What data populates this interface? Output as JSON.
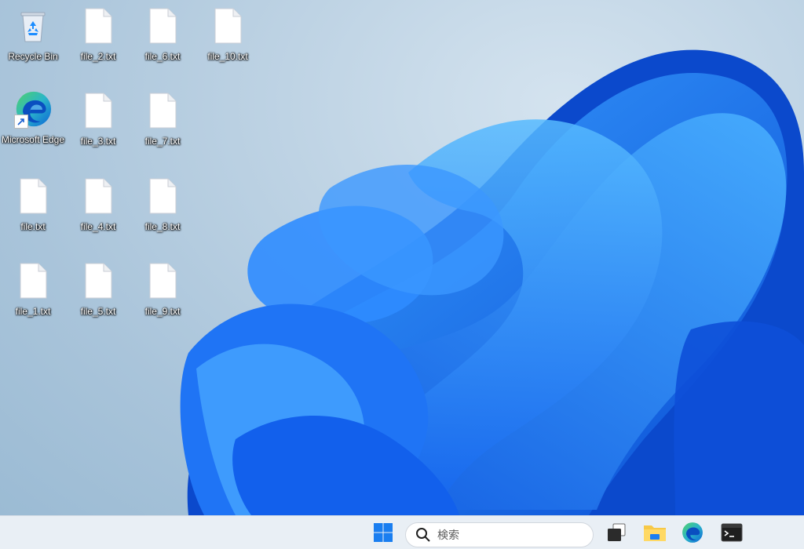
{
  "desktop": {
    "icons": [
      {
        "label": "Recycle Bin",
        "icon": "recycle-bin-icon"
      },
      {
        "label": "file_2.txt",
        "icon": "text-file-icon"
      },
      {
        "label": "file_6.txt",
        "icon": "text-file-icon"
      },
      {
        "label": "file_10.txt",
        "icon": "text-file-icon"
      },
      {
        "label": "Microsoft Edge",
        "icon": "edge-icon"
      },
      {
        "label": "file_3.txt",
        "icon": "text-file-icon"
      },
      {
        "label": "file_7.txt",
        "icon": "text-file-icon"
      },
      {
        "label": "file.txt",
        "icon": "text-file-icon"
      },
      {
        "label": "file_4.txt",
        "icon": "text-file-icon"
      },
      {
        "label": "file_8.txt",
        "icon": "text-file-icon"
      },
      {
        "label": "file_1.txt",
        "icon": "text-file-icon"
      },
      {
        "label": "file_5.txt",
        "icon": "text-file-icon"
      },
      {
        "label": "file_9.txt",
        "icon": "text-file-icon"
      }
    ]
  },
  "taskbar": {
    "search_placeholder": "検索",
    "apps": [
      "start-icon",
      "search-icon",
      "task-view-icon",
      "file-explorer-icon",
      "edge-icon",
      "terminal-icon"
    ]
  },
  "colors": {
    "wallpaper_bloom": "#1a6cf0",
    "taskbar_bg": "#e9eff5",
    "accent": "#0067c0"
  }
}
